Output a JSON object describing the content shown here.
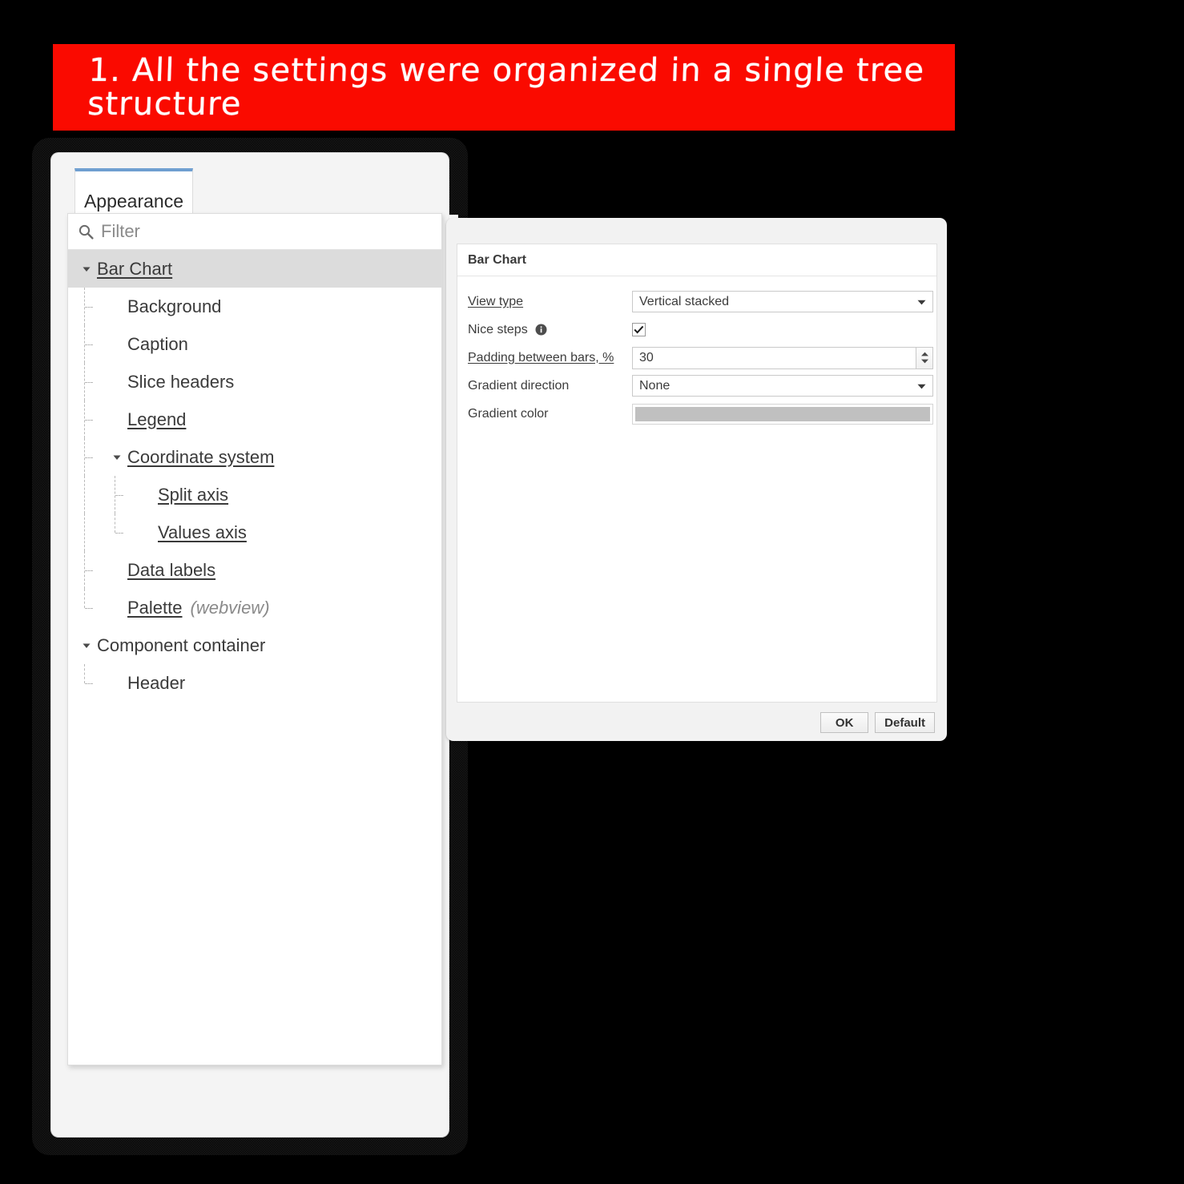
{
  "banner": {
    "text": "1. All the settings were organized in a single tree structure",
    "background_color": "#fa0a00",
    "text_color": "#ffffff"
  },
  "settings_dialog": {
    "tabs": [
      {
        "label": "Appearance",
        "active": true,
        "accent_color": "#6f9fd0"
      }
    ],
    "filter": {
      "placeholder": "Filter",
      "value": "",
      "icon": "search-icon"
    },
    "tree": {
      "selected": "Bar Chart",
      "items": [
        {
          "label": "Bar Chart",
          "depth": 0,
          "expandable": true,
          "expanded": true,
          "link": true,
          "selected": true,
          "suffix": ""
        },
        {
          "label": "Background",
          "depth": 1,
          "expandable": false,
          "expanded": false,
          "link": false,
          "selected": false,
          "suffix": ""
        },
        {
          "label": "Caption",
          "depth": 1,
          "expandable": false,
          "expanded": false,
          "link": false,
          "selected": false,
          "suffix": ""
        },
        {
          "label": "Slice headers",
          "depth": 1,
          "expandable": false,
          "expanded": false,
          "link": false,
          "selected": false,
          "suffix": ""
        },
        {
          "label": "Legend",
          "depth": 1,
          "expandable": false,
          "expanded": false,
          "link": true,
          "selected": false,
          "suffix": ""
        },
        {
          "label": "Coordinate system",
          "depth": 1,
          "expandable": true,
          "expanded": true,
          "link": true,
          "selected": false,
          "suffix": ""
        },
        {
          "label": "Split axis",
          "depth": 2,
          "expandable": false,
          "expanded": false,
          "link": true,
          "selected": false,
          "suffix": ""
        },
        {
          "label": "Values axis",
          "depth": 2,
          "expandable": false,
          "expanded": false,
          "link": true,
          "selected": false,
          "suffix": ""
        },
        {
          "label": "Data labels",
          "depth": 1,
          "expandable": false,
          "expanded": false,
          "link": true,
          "selected": false,
          "suffix": ""
        },
        {
          "label": "Palette",
          "depth": 1,
          "expandable": false,
          "expanded": false,
          "link": true,
          "selected": false,
          "suffix": "(webview)"
        },
        {
          "label": "Component container",
          "depth": 0,
          "expandable": true,
          "expanded": true,
          "link": false,
          "selected": false,
          "suffix": ""
        },
        {
          "label": "Header",
          "depth": 1,
          "expandable": false,
          "expanded": false,
          "link": false,
          "selected": false,
          "suffix": ""
        }
      ]
    }
  },
  "properties_dialog": {
    "title": "Bar Chart",
    "fields": [
      {
        "label": "View type",
        "label_link": true,
        "type": "select",
        "value": "Vertical stacked",
        "info": false
      },
      {
        "label": "Nice steps",
        "label_link": false,
        "type": "checkbox",
        "value": "checked",
        "info": true,
        "info_icon": "info-icon"
      },
      {
        "label": "Padding between bars, %",
        "label_link": true,
        "type": "spinner",
        "value": "30",
        "info": false
      },
      {
        "label": "Gradient direction",
        "label_link": false,
        "type": "select",
        "value": "None",
        "info": false
      },
      {
        "label": "Gradient color",
        "label_link": false,
        "type": "color",
        "value": "#c0c0c0",
        "info": false
      }
    ],
    "buttons": [
      {
        "label": "OK"
      },
      {
        "label": "Default"
      }
    ]
  }
}
